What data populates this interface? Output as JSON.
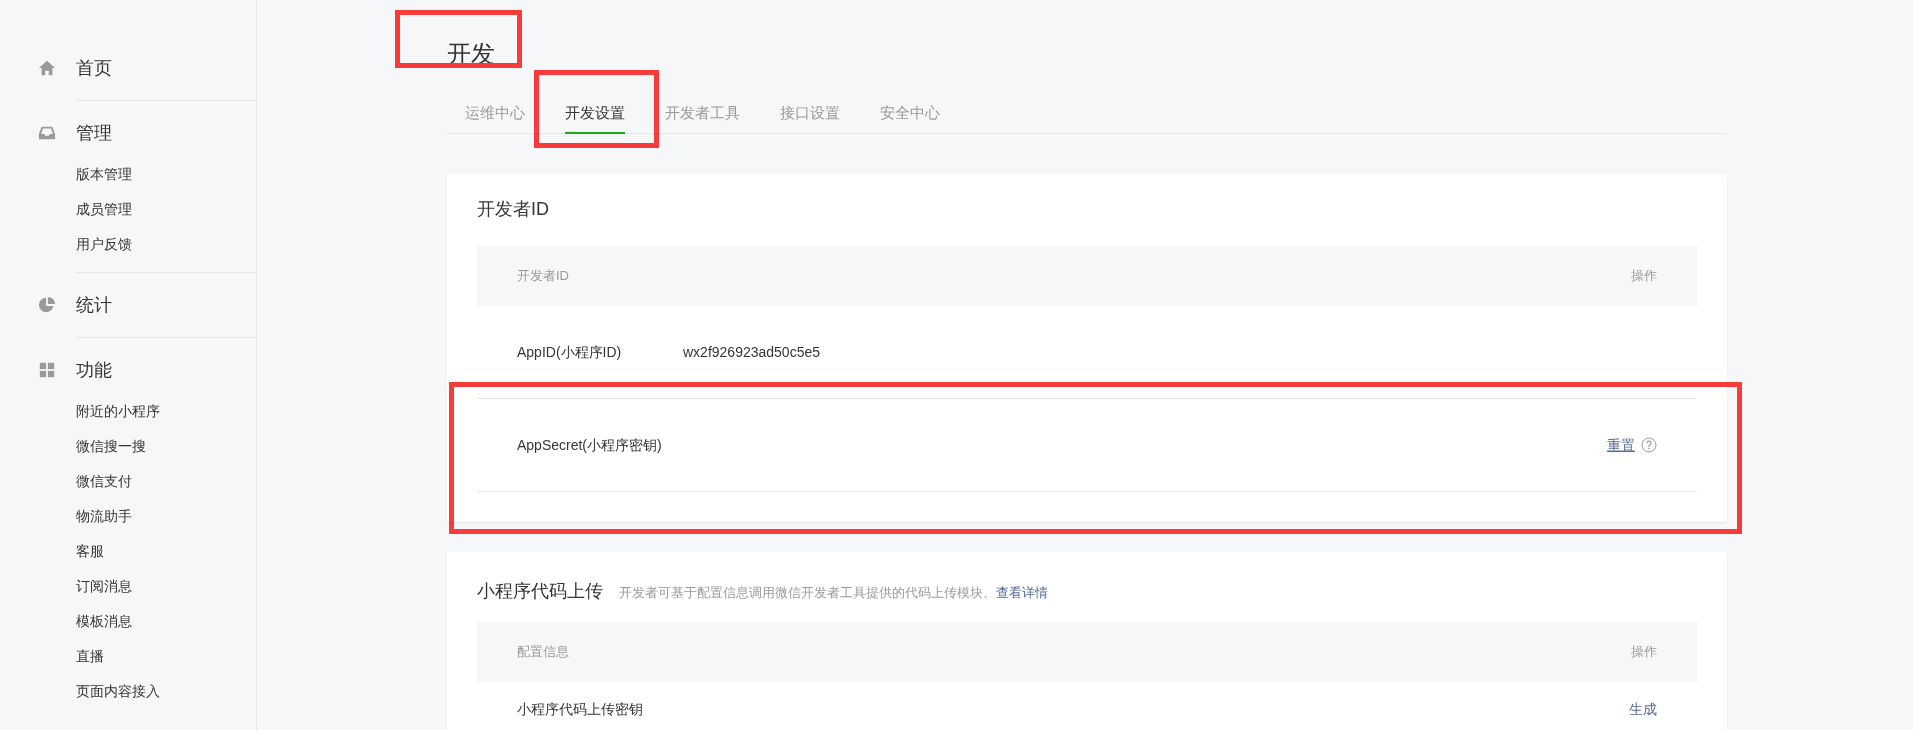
{
  "sidebar": {
    "sections": [
      {
        "label": "首页"
      },
      {
        "label": "管理",
        "children": [
          "版本管理",
          "成员管理",
          "用户反馈"
        ]
      },
      {
        "label": "统计"
      },
      {
        "label": "功能",
        "children": [
          "附近的小程序",
          "微信搜一搜",
          "微信支付",
          "物流助手",
          "客服",
          "订阅消息",
          "模板消息",
          "直播",
          "页面内容接入"
        ]
      }
    ]
  },
  "page_title": "开发",
  "tabs": [
    {
      "label": "运维中心",
      "selected": false
    },
    {
      "label": "开发设置",
      "selected": true
    },
    {
      "label": "开发者工具",
      "selected": false
    },
    {
      "label": "接口设置",
      "selected": false
    },
    {
      "label": "安全中心",
      "selected": false
    }
  ],
  "developer_id": {
    "title": "开发者ID",
    "columns": [
      "开发者ID",
      "操作"
    ],
    "rows": [
      {
        "name": "AppID(小程序ID)",
        "value": "wx2f926923ad50c5e5",
        "action": null
      },
      {
        "name": "AppSecret(小程序密钥)",
        "value": null,
        "action": "重置"
      }
    ]
  },
  "code_upload": {
    "title": "小程序代码上传",
    "description": "开发者可基于配置信息调用微信开发者工具提供的代码上传模块。",
    "link": "查看详情",
    "columns": [
      "配置信息",
      "操作"
    ],
    "rows": [
      {
        "name": "小程序代码上传密钥",
        "action": "生成"
      }
    ]
  }
}
